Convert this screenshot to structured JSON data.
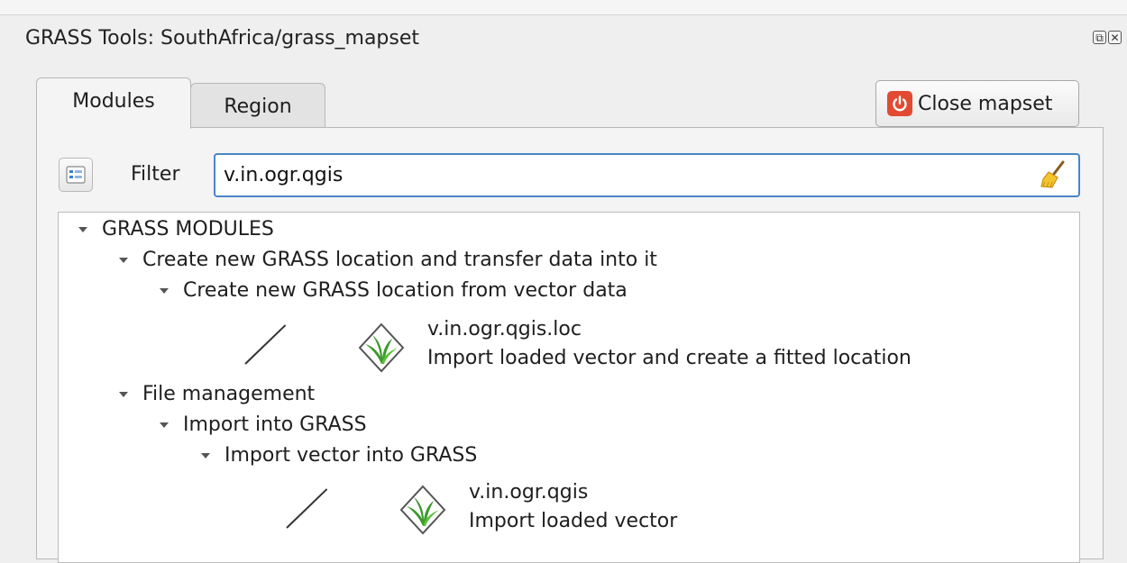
{
  "window": {
    "title": "GRASS Tools: SouthAfrica/grass_mapset",
    "float_button": "⧉",
    "close_button": "✕"
  },
  "tabs": [
    {
      "label": "Modules",
      "active": true
    },
    {
      "label": "Region",
      "active": false
    }
  ],
  "close_mapset": {
    "label": "Close mapset",
    "icon": "power-icon",
    "color": "#e14b32"
  },
  "filter": {
    "label": "Filter",
    "value": "v.in.ogr.qgis",
    "toggle_icon": "view-list-icon",
    "clear_icon": "broom-icon"
  },
  "tree": {
    "root": "GRASS MODULES",
    "group1": {
      "label": "Create new GRASS location and transfer data into it",
      "sub": "Create new GRASS location from vector data",
      "module": {
        "name": "v.in.ogr.qgis.loc",
        "description": "Import loaded vector and create a fitted location"
      }
    },
    "group2": {
      "label": "File management",
      "sub": "Import into GRASS",
      "subsub": "Import vector into GRASS",
      "module": {
        "name": "v.in.ogr.qgis",
        "description": "Import loaded vector"
      }
    }
  },
  "colors": {
    "accent": "#4a86c8",
    "icon_green": "#3a9a2a"
  }
}
